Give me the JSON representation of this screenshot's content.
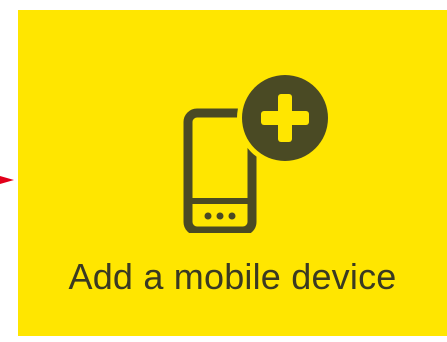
{
  "tile": {
    "label": "Add a mobile device",
    "background_color": "#ffe600",
    "icon": "phone-with-plus-icon",
    "icon_color": "#4a4a24"
  },
  "pointer": {
    "icon": "arrow-right-icon",
    "color": "#e2001a"
  }
}
